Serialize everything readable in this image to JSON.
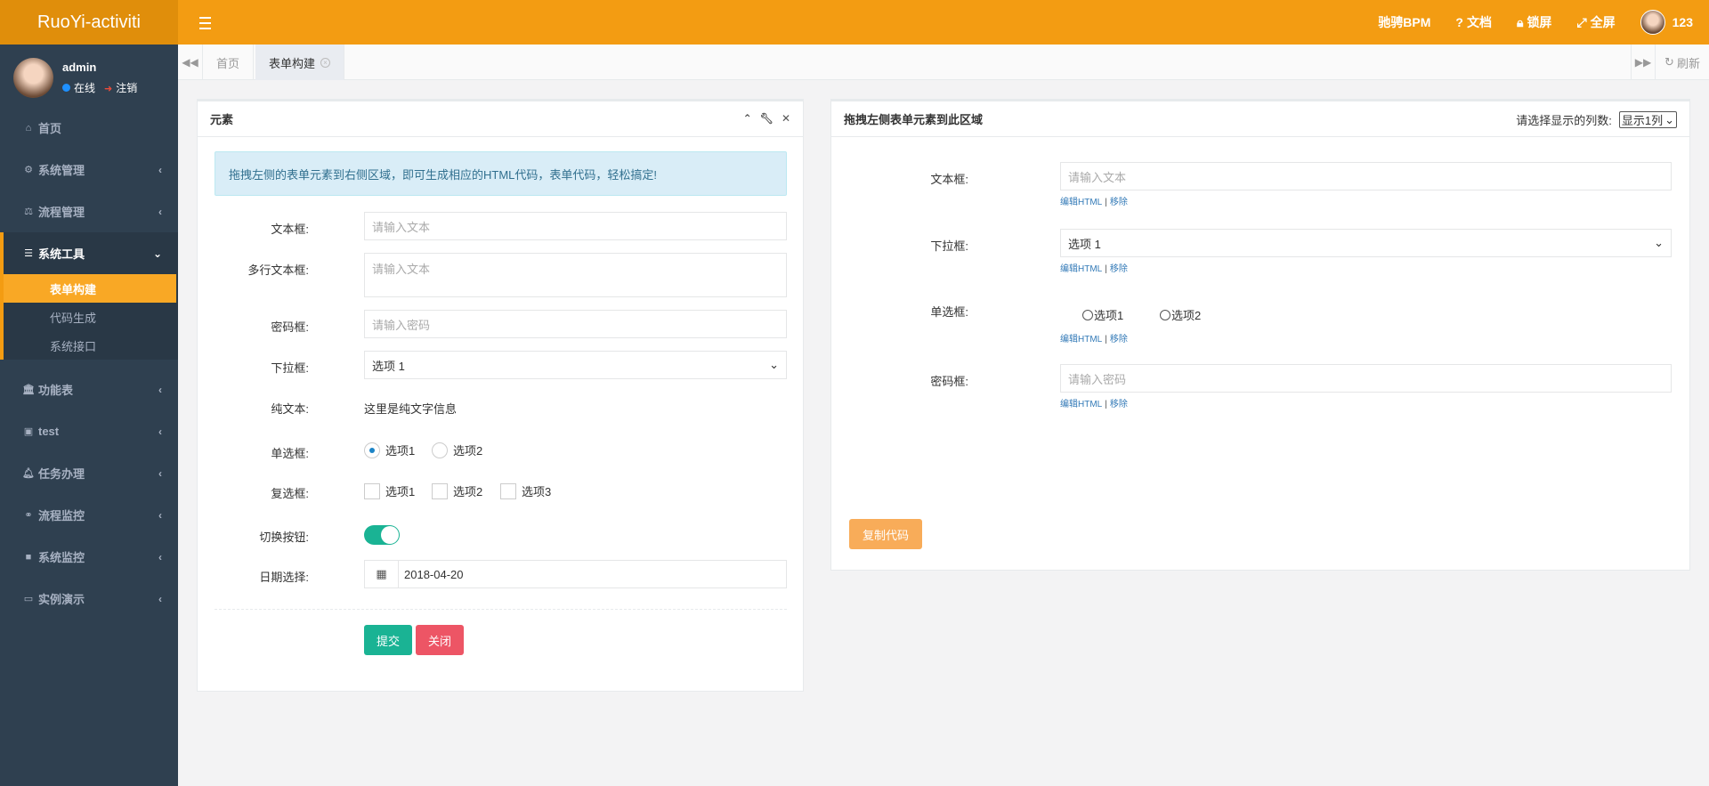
{
  "topbar": {
    "brand": "RuoYi-activiti",
    "links": [
      {
        "icon": "",
        "label": "驰骋BPM"
      },
      {
        "icon": "question-circle-icon",
        "label": "文档"
      },
      {
        "icon": "lock-icon",
        "label": "锁屏"
      },
      {
        "icon": "fullscreen-icon",
        "label": "全屏"
      }
    ],
    "user_name": "123"
  },
  "sidebar": {
    "user": {
      "name": "admin",
      "status": "在线",
      "logout": "注销"
    },
    "items": [
      {
        "icon": "home-icon",
        "label": "首页"
      },
      {
        "icon": "gear-icon",
        "label": "系统管理"
      },
      {
        "icon": "balance-scale-icon",
        "label": "流程管理"
      }
    ],
    "active_group": {
      "icon": "list-icon",
      "label": "系统工具",
      "children": [
        "表单构建",
        "代码生成",
        "系统接口"
      ]
    },
    "items_after": [
      {
        "icon": "bank-icon",
        "label": "功能表"
      },
      {
        "icon": "id-badge-icon",
        "label": "test"
      },
      {
        "icon": "bell-icon",
        "label": "任务办理"
      },
      {
        "icon": "binoculars-icon",
        "label": "流程监控"
      },
      {
        "icon": "video-camera-icon",
        "label": "系统监控"
      },
      {
        "icon": "desktop-icon",
        "label": "实例演示"
      }
    ]
  },
  "tabs": {
    "items": [
      "首页",
      "表单构建"
    ],
    "refresh": "刷新"
  },
  "left_panel": {
    "title": "元素",
    "alert": "拖拽左侧的表单元素到右侧区域，即可生成相应的HTML代码，表单代码，轻松搞定!",
    "fields": {
      "text_label": "文本框:",
      "text_placeholder": "请输入文本",
      "textarea_label": "多行文本框:",
      "textarea_placeholder": "请输入文本",
      "password_label": "密码框:",
      "password_placeholder": "请输入密码",
      "select_label": "下拉框:",
      "select_value": "选项 1",
      "plain_label": "纯文本:",
      "plain_value": "这里是纯文字信息",
      "radio_label": "单选框:",
      "radio_options": [
        "选项1",
        "选项2"
      ],
      "checkbox_label": "复选框:",
      "checkbox_options": [
        "选项1",
        "选项2",
        "选项3"
      ],
      "toggle_label": "切换按钮:",
      "date_label": "日期选择:",
      "date_value": "2018-04-20"
    },
    "submit": "提交",
    "close": "关闭"
  },
  "right_panel": {
    "title": "拖拽左侧表单元素到此区域",
    "cols_label": "请选择显示的列数:",
    "cols_value": "显示1列",
    "text_label": "文本框:",
    "text_placeholder": "请输入文本",
    "select_label": "下拉框:",
    "select_value": "选项 1",
    "radio_label": "单选框:",
    "radio_options": [
      "选项1",
      "选项2"
    ],
    "password_label": "密码框:",
    "password_placeholder": "请输入密码",
    "edit_link": "编辑HTML",
    "sep": "|",
    "remove_link": "移除",
    "copy_button": "复制代码"
  },
  "colors": {
    "accent": "#f39c12",
    "sidebar": "#2f4050",
    "primary": "#1ab394",
    "danger": "#ed5565",
    "warning": "#f8ac59"
  }
}
